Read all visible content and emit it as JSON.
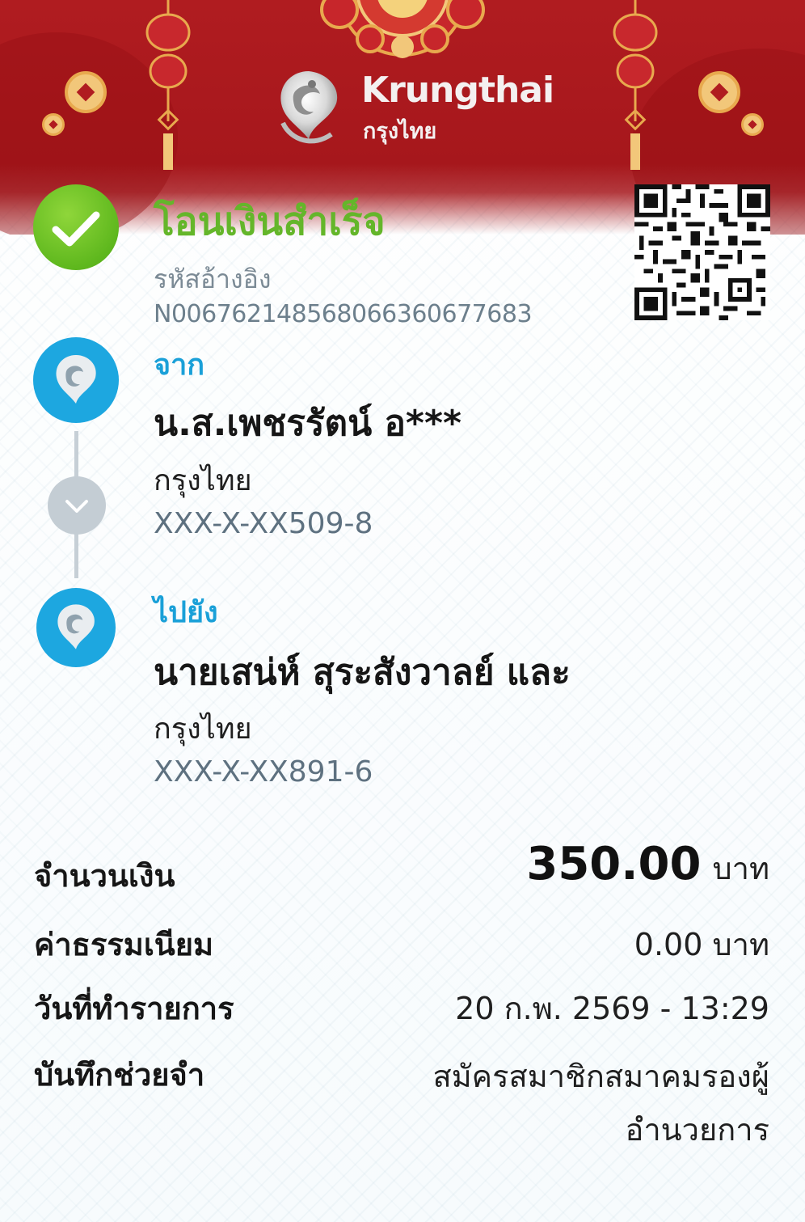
{
  "header": {
    "brand_en": "Krungthai",
    "brand_th": "กรุงไทย",
    "colors": {
      "banner_red": "#b01c20",
      "gold": "#f2c77a"
    }
  },
  "status": {
    "icon": "check-circle-icon",
    "title": "โอนเงินสำเร็จ",
    "ref_label": "รหัสอ้างอิง",
    "ref_value": "N006762148568066360677683",
    "color": "#64b62a"
  },
  "qr": {
    "icon": "qr-code"
  },
  "from": {
    "label": "จาก",
    "name": "น.ส.เพชรรัตน์ อ***",
    "bank": "กรุงไทย",
    "account": "XXX-X-XX509-8"
  },
  "to": {
    "label": "ไปยัง",
    "name": "นายเสน่ห์ สุระสังวาลย์ และ",
    "bank": "กรุงไทย",
    "account": "XXX-X-XX891-6"
  },
  "details": {
    "amount_label": "จำนวนเงิน",
    "amount_value": "350.00",
    "amount_unit": "บาท",
    "fee_label": "ค่าธรรมเนียม",
    "fee_value": "0.00 บาท",
    "date_label": "วันที่ทำรายการ",
    "date_value": "20 ก.พ. 2569 - 13:29",
    "memo_label": "บันทึกช่วยจำ",
    "memo_value": "สมัครสมาชิกสมาคมรองผู้อำนวยการ"
  },
  "accent_color": "#1da7e0"
}
